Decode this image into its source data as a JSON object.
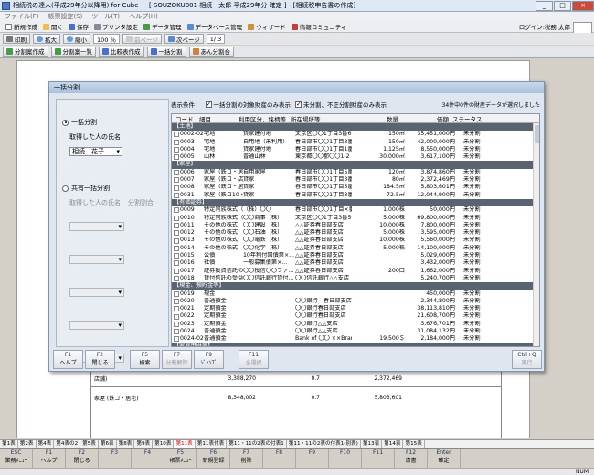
{
  "window": {
    "title": "相続税の達人(平成29年分以降用) for Cube － [ SOUZOKU001 相続　太郎 平成29年分 確定 ] - [相続税申告書の作成]",
    "controls": [
      "_",
      "□",
      "×"
    ]
  },
  "menu": [
    "ファイル(F)",
    "帳票設定(S)",
    "ツール(T)",
    "ヘルプ(H)"
  ],
  "toolbar1": [
    "新規作成",
    "開く",
    "保存",
    "プリンタ設定",
    "データ管理",
    "データベース管理",
    "ウィザード",
    "情報コミュニティ"
  ],
  "login": "ログイン:税務 太郎",
  "logo": "TATSUZIN",
  "toolbar2": {
    "print": "印刷",
    "zoom_in": "拡大",
    "zoom_out": "縮小",
    "zoom": "100 ％",
    "prev": "前ページ",
    "next": "次ページ",
    "page": "1/ 3"
  },
  "toolbar3": [
    "分割案作成",
    "分割案一覧",
    "比較表作成",
    "一括分割",
    "あん分割合"
  ],
  "dialog": {
    "title": "一括分割",
    "mode_single": "一括分割",
    "acquirer_label": "取得した人の氏名",
    "acquirer": "相続　花子",
    "mode_joint": "共有一括分割",
    "col_name": "取得した人の氏名",
    "col_ratio": "分割割合",
    "cond_label": "表示条件：",
    "cond1": "一括分割の対象財産のみ表示",
    "cond2": "未分割、不正分割財産のみ表示",
    "count_msg": "34件中0件の財産データが選択しました",
    "headers": [
      "コード",
      "細目",
      "利用区分、銘柄等",
      "所在場所等",
      "数量",
      "価額",
      "ステータス"
    ],
    "rows": [
      {
        "t": "s",
        "name": "【土地】"
      },
      {
        "code": "0002-02",
        "sub": "宅地",
        "use": "貸家建付地",
        "loc": "文京区〇〇1丁目3番6号",
        "qty": "150㎡",
        "val": "35,451,000円",
        "st": "未分割"
      },
      {
        "code": "0003",
        "sub": "宅地",
        "use": "自用地（未利用）",
        "loc": "春日部市〇〇1丁目3番4号",
        "qty": "150㎡",
        "val": "42,000,000円",
        "st": "未分割"
      },
      {
        "code": "0004",
        "sub": "宅地",
        "use": "貸家建付地",
        "loc": "春日部市〇〇1丁目1番",
        "qty": "1,125㎡",
        "val": "8,550,000円",
        "st": "未分割"
      },
      {
        "code": "0005",
        "sub": "山林",
        "use": "普通山林",
        "loc": "東京都〇〇郡〇〇1-2",
        "qty": "30,000㎡",
        "val": "3,617,100円",
        "st": "未分割"
      },
      {
        "t": "s",
        "name": "【家屋】"
      },
      {
        "code": "0006",
        "sub": "家屋（鉄コ・居宅）",
        "use": "自用家屋",
        "loc": "春日部市〇〇1丁目5番16号",
        "qty": "120㎡",
        "val": "3,874,860円",
        "st": "未分割"
      },
      {
        "code": "0007",
        "sub": "家屋（鉄コ・店舗）",
        "use": "貸家",
        "loc": "春日部市〇〇1丁目3番5号",
        "qty": "80㎡",
        "val": "2,372,469円",
        "st": "未分割"
      },
      {
        "code": "0008",
        "sub": "家屋（鉄コ・居宅）",
        "use": "貸家",
        "loc": "春日部市〇〇1丁目5番16号",
        "qty": "184.5㎡",
        "val": "5,803,601円",
        "st": "未分割"
      },
      {
        "code": "0031",
        "sub": "家屋（鉄コ10・居宅）",
        "use": "貸家",
        "loc": "春日部市〇〇1丁目3番6号（1...",
        "qty": "72.5㎡",
        "val": "12,044,900円",
        "st": "未分割"
      },
      {
        "t": "s",
        "name": "【有価証券】"
      },
      {
        "code": "0009",
        "sub": "特定同族株式（配当...",
        "use": "（株）〇〇",
        "loc": "春日部市〇〇1丁目×番×号",
        "qty": "1,000株",
        "val": "50,000円",
        "st": "未分割"
      },
      {
        "code": "0010",
        "sub": "特定同族株式（その...",
        "use": "〇〇商事（株）",
        "loc": "文京区〇〇1丁目3番5号",
        "qty": "5,000株",
        "val": "69,800,000円",
        "st": "未分割"
      },
      {
        "code": "0011",
        "sub": "その他の株式",
        "use": "〇〇建設（株）",
        "loc": "△△証券春日部支店",
        "qty": "10,000株",
        "val": "7,800,000円",
        "st": "未分割"
      },
      {
        "code": "0012",
        "sub": "その他の株式",
        "use": "〇〇石油（株）",
        "loc": "△△証券春日部支店",
        "qty": "5,000株",
        "val": "3,595,000円",
        "st": "未分割"
      },
      {
        "code": "0013",
        "sub": "その他の株式",
        "use": "〇〇電鉄（株）",
        "loc": "△△証券春日部支店",
        "qty": "10,000株",
        "val": "5,560,000円",
        "st": "未分割"
      },
      {
        "code": "0014",
        "sub": "その他の株式",
        "use": "〇〇化学（株）",
        "loc": "△△証券春日部支店",
        "qty": "5,000株",
        "val": "14,100,000円",
        "st": "未分割"
      },
      {
        "code": "0015",
        "sub": "公債",
        "use": "10年利付国債第×...",
        "loc": "△△証券春日部支店",
        "qty": "",
        "val": "5,029,000円",
        "st": "未分割"
      },
      {
        "code": "0016",
        "sub": "社債",
        "use": "一般募集債第×...",
        "loc": "△△証券春日部支店",
        "qty": "",
        "val": "3,432,000円",
        "st": "未分割"
      },
      {
        "code": "0017",
        "sub": "証券投資信託の受益...",
        "use": "〇〇投信〇〇ファ...",
        "loc": "△△証券春日部支店",
        "qty": "200口",
        "val": "1,662,000円",
        "st": "未分割"
      },
      {
        "code": "0018",
        "sub": "貸付信託の受益証券",
        "use": "〇〇信託銀行貸付...",
        "loc": "〇〇信託銀行△△支店",
        "qty": "",
        "val": "5,240,700円",
        "st": "未分割"
      },
      {
        "t": "s",
        "name": "【現金、預貯金等】"
      },
      {
        "code": "0019",
        "sub": "現金",
        "use": "",
        "loc": "",
        "qty": "",
        "val": "450,000円",
        "st": "未分割"
      },
      {
        "code": "0020",
        "sub": "普通預金",
        "use": "",
        "loc": "〇〇銀行　春日部支店",
        "qty": "",
        "val": "2,344,800円",
        "st": "未分割"
      },
      {
        "code": "0021",
        "sub": "定期預金",
        "use": "",
        "loc": "〇〇銀行春日部支店",
        "qty": "",
        "val": "38,113,810円",
        "st": "未分割"
      },
      {
        "code": "0022",
        "sub": "定期預金",
        "use": "",
        "loc": "〇〇銀行春日部支店",
        "qty": "",
        "val": "21,608,700円",
        "st": "未分割"
      },
      {
        "code": "0023",
        "sub": "定期預金",
        "use": "",
        "loc": "〇〇銀行△△支店",
        "qty": "",
        "val": "3,676,701円",
        "st": "未分割"
      },
      {
        "code": "0024",
        "sub": "普通預金",
        "use": "",
        "loc": "〇〇銀行△△支店",
        "qty": "",
        "val": "31,084,132円",
        "st": "未分割"
      },
      {
        "code": "0024-02",
        "sub": "普通預金",
        "use": "",
        "loc": "Bank of 〇〇 ××Branch",
        "qty": "19,500＄",
        "val": "2,184,000円",
        "st": "未分割"
      },
      {
        "t": "s",
        "name": "【家庭用財産】"
      },
      {
        "code": "0025",
        "sub": "",
        "use": "家具等一式",
        "loc": "春日部市〇〇1丁目5番16号",
        "qty": "",
        "val": "2,500,000円",
        "st": "未分割"
      },
      {
        "t": "s",
        "name": "【その他の財産】"
      }
    ],
    "fkeys": [
      {
        "k": "F1",
        "l": "ヘルプ"
      },
      {
        "k": "F2",
        "l": "閉じる"
      },
      {
        "k": "F5",
        "l": "検索"
      },
      {
        "k": "F7",
        "l": "分割解除",
        "d": true
      },
      {
        "k": "F9",
        "l": "ｼﾞｬﾝﾌﾟ"
      },
      {
        "k": "F11",
        "l": "全選択",
        "d": true
      },
      {
        "k": "Ctrl+Q",
        "l": "実行",
        "d": true
      }
    ]
  },
  "background_rows": [
    {
      "a": "店舗)",
      "b": "3,388,270",
      "c": "0.7",
      "d": "2,372,469"
    },
    {
      "a": "家屋 (鉄コ・居宅)",
      "b": "8,348,002",
      "c": "0.7",
      "d": "5,803,601"
    }
  ],
  "sheet_tabs": [
    "第1表",
    "第2表",
    "第4表",
    "第4表の2",
    "第5表",
    "第6表",
    "第8表",
    "第9表",
    "第10表",
    "第11表",
    "第11表付表",
    "第11・11の2表の付表1",
    "第11・11の2表の付表1(別表)",
    "第13表",
    "第14表",
    "第15表"
  ],
  "active_tab": "第11表",
  "bottom_keys": [
    {
      "k": "ESC",
      "l": "業務ﾒﾆｭｰ"
    },
    {
      "k": "F1",
      "l": "ヘルプ"
    },
    {
      "k": "F2",
      "l": "閉じる"
    },
    {
      "k": "F3",
      "l": ""
    },
    {
      "k": "F4",
      "l": ""
    },
    {
      "k": "F5",
      "l": "帳票ﾒﾆｭｰ"
    },
    {
      "k": "F6",
      "l": "新規登録"
    },
    {
      "k": "F7",
      "l": "削除"
    },
    {
      "k": "F8",
      "l": ""
    },
    {
      "k": "F9",
      "l": ""
    },
    {
      "k": "F10",
      "l": ""
    },
    {
      "k": "F11",
      "l": ""
    },
    {
      "k": "F12",
      "l": "清書"
    },
    {
      "k": "Enter",
      "l": "確定"
    }
  ],
  "status": "NUM"
}
